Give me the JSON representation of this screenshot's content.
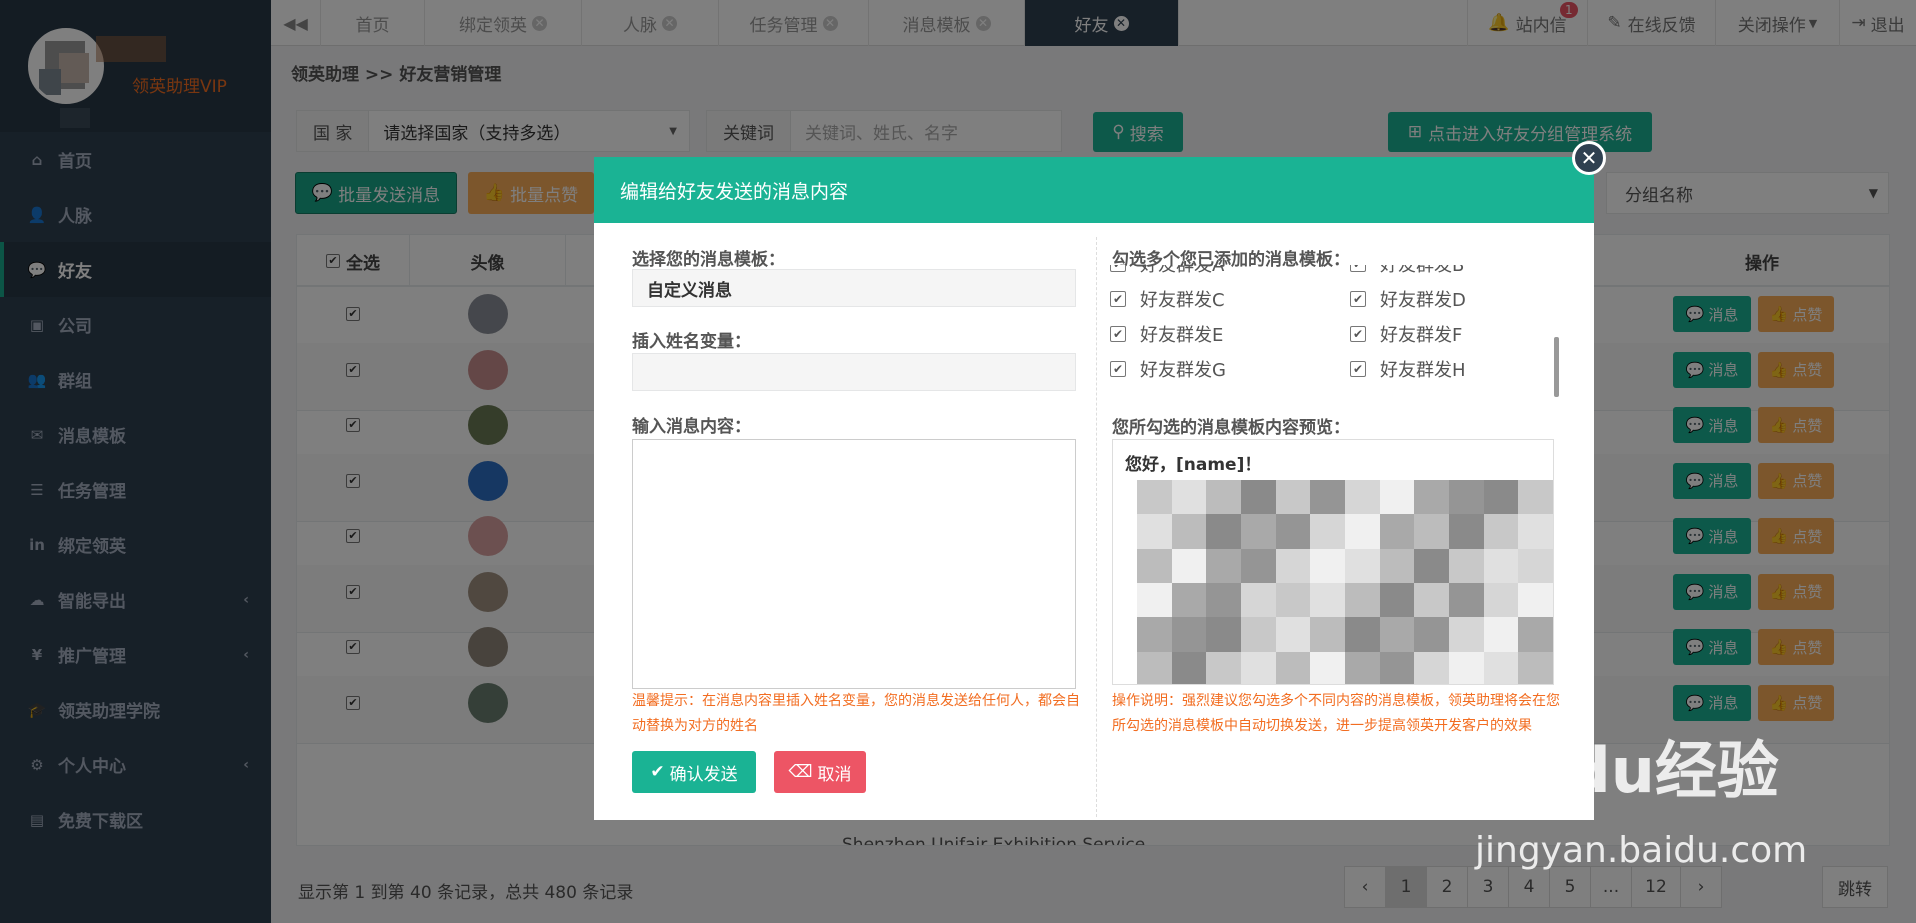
{
  "sidebar": {
    "vip_label": "领英助理VIP",
    "items": [
      {
        "label": "首页",
        "icon": "home-icon",
        "glyph": "⌂"
      },
      {
        "label": "人脉",
        "icon": "user-plus-icon",
        "glyph": "👤"
      },
      {
        "label": "好友",
        "icon": "comments-icon",
        "glyph": "💬"
      },
      {
        "label": "公司",
        "icon": "briefcase-icon",
        "glyph": "▣"
      },
      {
        "label": "群组",
        "icon": "users-icon",
        "glyph": "👥"
      },
      {
        "label": "消息模板",
        "icon": "envelope-icon",
        "glyph": "✉"
      },
      {
        "label": "任务管理",
        "icon": "tasks-icon",
        "glyph": "☰"
      },
      {
        "label": "绑定领英",
        "icon": "linkedin-icon",
        "glyph": "in"
      },
      {
        "label": "智能导出",
        "icon": "cloud-download-icon",
        "glyph": "☁"
      },
      {
        "label": "推广管理",
        "icon": "yen-icon",
        "glyph": "¥"
      },
      {
        "label": "领英助理学院",
        "icon": "graduation-cap-icon",
        "glyph": "🎓"
      },
      {
        "label": "个人中心",
        "icon": "gear-icon",
        "glyph": "⚙"
      },
      {
        "label": "免费下载区",
        "icon": "file-icon",
        "glyph": "▤"
      }
    ]
  },
  "tabs": {
    "home": "首页",
    "bind": "绑定领英",
    "contacts": "人脉",
    "tasks": "任务管理",
    "templates": "消息模板",
    "friends": "好友"
  },
  "topbar": {
    "inbox": "站内信",
    "inbox_badge": "1",
    "feedback": "在线反馈",
    "close_ops": "关闭操作",
    "logout": "退出"
  },
  "breadcrumb": "领英助理 >> 好友营销管理",
  "filters": {
    "country_label": "国 家",
    "country_value": "请选择国家（支持多选）",
    "keyword_label": "关键词",
    "keyword_placeholder": "关键词、姓氏、名字",
    "search_button": "搜索",
    "group_system_button": "点击进入好友分组管理系统",
    "group_select": "分组名称"
  },
  "actions": {
    "batch_message": "批量发送消息",
    "batch_like": "批量点赞"
  },
  "table": {
    "headers": {
      "select_all": "全选",
      "avatar": "头像",
      "operation": "操作"
    },
    "row_message": "消息",
    "row_like": "点赞",
    "partial_text": "Shenzhen Unifair Exhibition Service"
  },
  "footer": {
    "info": "显示第 1 到第 40 条记录，总共 480 条记录",
    "pages": [
      "‹",
      "1",
      "2",
      "3",
      "4",
      "5",
      "...",
      "12",
      "›"
    ],
    "jump": "跳转"
  },
  "modal": {
    "title": "编辑给好友发送的消息内容",
    "template_label": "选择您的消息模板：",
    "template_value": "自定义消息",
    "name_var_label": "插入姓名变量：",
    "content_label": "输入消息内容：",
    "tip_left": "温馨提示：在消息内容里插入姓名变量，您的消息发送给任何人，都会自动替换为对方的姓名",
    "confirm_button": "确认发送",
    "cancel_button": "取消",
    "multi_label": "勾选多个您已添加的消息模板：",
    "templates": [
      "好友群发A",
      "好友群发B",
      "好友群发C",
      "好友群发D",
      "好友群发E",
      "好友群发F",
      "好友群发G",
      "好友群发H"
    ],
    "preview_label": "您所勾选的消息模板内容预览：",
    "preview_line1": "您好，[name]！",
    "tip_right": "操作说明：强烈建议您勾选多个不同内容的消息模板，领英助理将会在您所勾选的消息模板中自动切换发送，进一步提高领英开发客户的效果"
  },
  "watermark": {
    "brand": "Baidu经验",
    "url": "jingyan.baidu.com"
  },
  "colors": {
    "primary": "#1ab394",
    "warning": "#f8ac59",
    "danger": "#ed5565",
    "sidebar": "#2f4050",
    "tip": "#f26d21"
  }
}
